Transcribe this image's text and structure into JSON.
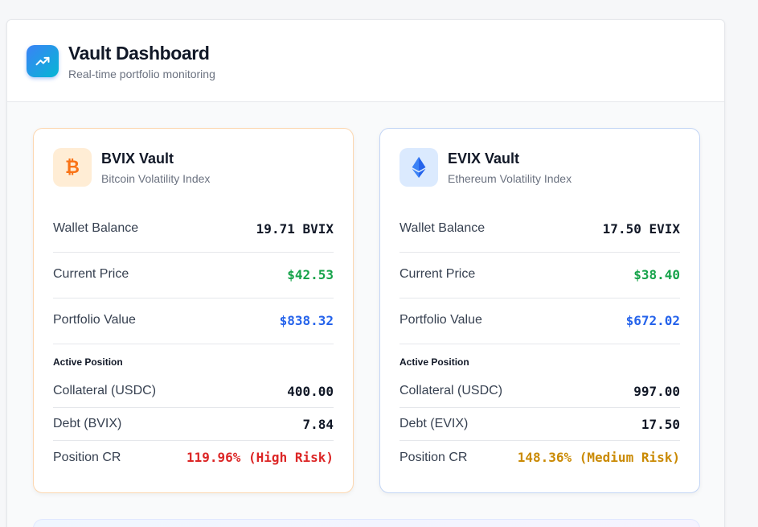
{
  "header": {
    "title": "Vault Dashboard",
    "subtitle": "Real-time portfolio monitoring",
    "logo_icon": "trending-up-icon"
  },
  "colors": {
    "accent_blue": "#3b82f6",
    "accent_cyan": "#06b6d4",
    "positive_green": "#16a34a",
    "value_blue": "#2563eb",
    "risk_high": "#dc2626",
    "risk_medium": "#ca8a04",
    "bvix_accent": "#f97316",
    "evix_accent": "#3b82f6"
  },
  "vaults": [
    {
      "name": "BVIX Vault",
      "description": "Bitcoin Volatility Index",
      "icon": "bitcoin-icon",
      "wallet_balance_label": "Wallet Balance",
      "wallet_balance": "19.71 BVIX",
      "current_price_label": "Current Price",
      "current_price": "$42.53",
      "portfolio_value_label": "Portfolio Value",
      "portfolio_value": "$838.32",
      "position_heading": "Active Position",
      "collateral_label": "Collateral (USDC)",
      "collateral": "400.00",
      "debt_label": "Debt (BVIX)",
      "debt": "7.84",
      "cr_label": "Position CR",
      "cr": "119.96% (High Risk)"
    },
    {
      "name": "EVIX Vault",
      "description": "Ethereum Volatility Index",
      "icon": "ethereum-icon",
      "wallet_balance_label": "Wallet Balance",
      "wallet_balance": "17.50 EVIX",
      "current_price_label": "Current Price",
      "current_price": "$38.40",
      "portfolio_value_label": "Portfolio Value",
      "portfolio_value": "$672.02",
      "position_heading": "Active Position",
      "collateral_label": "Collateral (USDC)",
      "collateral": "997.00",
      "debt_label": "Debt (EVIX)",
      "debt": "17.50",
      "cr_label": "Position CR",
      "cr": "148.36% (Medium Risk)"
    }
  ]
}
